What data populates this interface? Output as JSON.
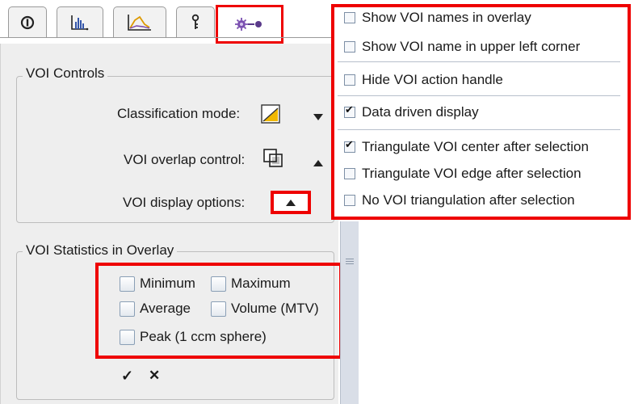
{
  "voi_controls": {
    "title": "VOI Controls",
    "classification_mode": "Classification mode:",
    "overlap_control": "VOI overlap control:",
    "display_options": "VOI display options:"
  },
  "statistics": {
    "title": "VOI Statistics in Overlay",
    "checkboxes": [
      {
        "label": "Minimum",
        "checked": false
      },
      {
        "label": "Maximum",
        "checked": false
      },
      {
        "label": "Average",
        "checked": false
      },
      {
        "label": "Volume (MTV)",
        "checked": false
      },
      {
        "label": "Peak (1 ccm sphere)",
        "checked": false
      }
    ],
    "apply_symbol": "✓",
    "clear_symbol": "✕"
  },
  "menu": {
    "items": [
      {
        "label": "Show VOI names in overlay",
        "checked": false
      },
      {
        "label": "Show VOI name in upper left corner",
        "checked": false
      },
      {
        "label": "Hide VOI action handle",
        "checked": false
      },
      {
        "label": "Data driven display",
        "checked": true
      },
      {
        "label": "Triangulate VOI center after selection",
        "checked": true
      },
      {
        "label": "Triangulate VOI edge after selection",
        "checked": false
      },
      {
        "label": "No VOI triangulation after selection",
        "checked": false
      }
    ]
  },
  "tabs": [
    {
      "icon": "info-icon"
    },
    {
      "icon": "histogram-icon"
    },
    {
      "icon": "curve-icon"
    },
    {
      "icon": "key-icon"
    },
    {
      "icon": "voi-settings-icon",
      "active": true
    }
  ],
  "colors": {
    "highlight": "#ee0000",
    "panel": "#eeeeee"
  }
}
